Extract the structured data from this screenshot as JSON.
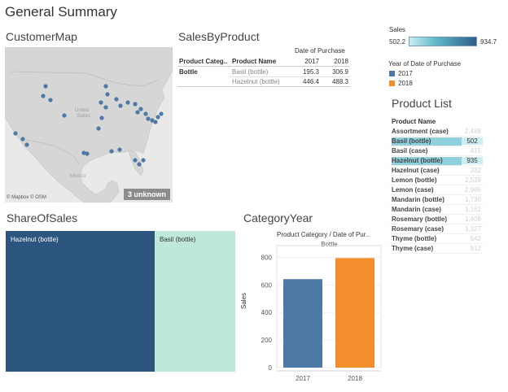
{
  "page_title": "General Summary",
  "customer_map": {
    "title": "CustomerMap",
    "labels": {
      "country_us": "United\nStates",
      "country_mexico": "Mexico"
    },
    "attribution": "© Mapbox © OSM",
    "unknown_badge": "3 unknown",
    "colors": {
      "land": "#d6d6d6",
      "water": "#e9e9e9",
      "dot": "#4e79a7"
    }
  },
  "sales_by_product": {
    "title": "SalesByProduct",
    "column_group": "Date of Purchase",
    "headers": {
      "category": "Product Categ..",
      "product": "Product Name",
      "y2017": "2017",
      "y2018": "2018"
    },
    "rows": [
      {
        "category": "Bottle",
        "product": "Basil (bottle)",
        "v2017": "195.3",
        "v2018": "306.9"
      },
      {
        "category": "",
        "product": "Hazelnut (bottle)",
        "v2017": "446.4",
        "v2018": "488.3"
      }
    ]
  },
  "legend_sales": {
    "title": "Sales",
    "min": "502.2",
    "max": "934.7"
  },
  "legend_year": {
    "title": "Year of Date of Purchase",
    "items": [
      {
        "label": "2017",
        "color": "#4e79a7"
      },
      {
        "label": "2018",
        "color": "#f28e2b"
      }
    ]
  },
  "product_list": {
    "title": "Product List",
    "header": "Product Name",
    "rows": [
      {
        "name": "Assortment (case)",
        "value": "2,488",
        "selected": false
      },
      {
        "name": "Basil (bottle)",
        "value": "502",
        "selected": true
      },
      {
        "name": "Basil (case)",
        "value": "415",
        "selected": false
      },
      {
        "name": "Hazelnut (bottle)",
        "value": "935",
        "selected": true
      },
      {
        "name": "Hazelnut (case)",
        "value": "332",
        "selected": false
      },
      {
        "name": "Lemon (bottle)",
        "value": "2,539",
        "selected": false
      },
      {
        "name": "Lemon (case)",
        "value": "2,986",
        "selected": false
      },
      {
        "name": "Mandarin (bottle)",
        "value": "1,730",
        "selected": false
      },
      {
        "name": "Mandarin (case)",
        "value": "1,161",
        "selected": false
      },
      {
        "name": "Rosemary (bottle)",
        "value": "1,408",
        "selected": false
      },
      {
        "name": "Rosemary (case)",
        "value": "1,327",
        "selected": false
      },
      {
        "name": "Thyme (bottle)",
        "value": "642",
        "selected": false
      },
      {
        "name": "Thyme (case)",
        "value": "912",
        "selected": false
      }
    ]
  },
  "share_of_sales": {
    "title": "ShareOfSales",
    "tiles": [
      {
        "label": "Hazelnut (bottle)",
        "value": 934.7,
        "color": "#2c5580",
        "text_color": "#ffffff"
      },
      {
        "label": "Basil (bottle)",
        "value": 502.2,
        "color": "#bfe8dc",
        "text_color": "#333333"
      }
    ]
  },
  "category_year": {
    "title": "CategoryYear",
    "header": "Product Category / Date of Pur..",
    "subheader": "Bottle",
    "ylabel": "Sales"
  },
  "chart_data": {
    "type": "bar",
    "categories": [
      "2017",
      "2018"
    ],
    "values": [
      642,
      795
    ],
    "colors": [
      "#4e79a7",
      "#f28e2b"
    ],
    "ylabel": "Sales",
    "yticks": [
      0,
      200,
      400,
      600,
      800
    ],
    "ylim": [
      0,
      850
    ]
  }
}
